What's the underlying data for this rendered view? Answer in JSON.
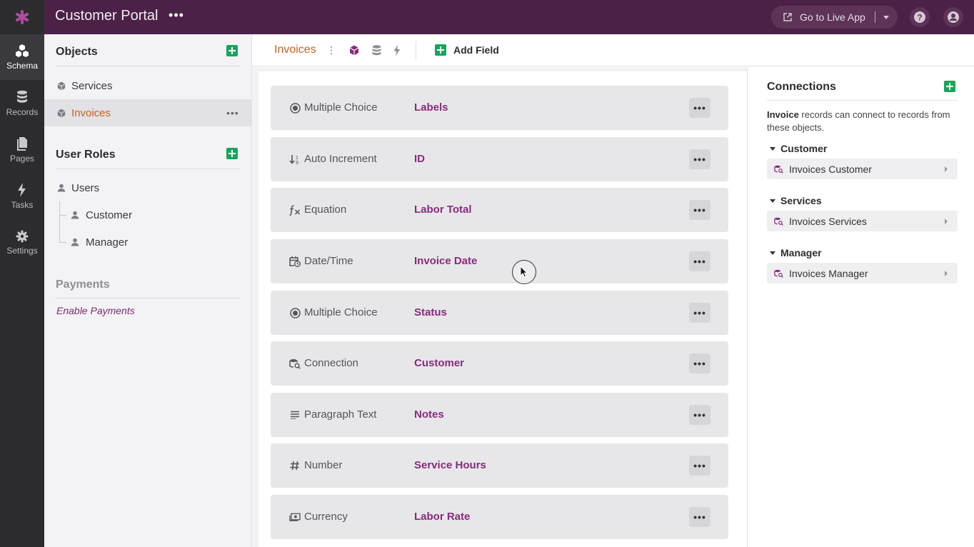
{
  "app": {
    "title": "Customer Portal",
    "menu_label": "•••",
    "go_live_label": "Go to Live App",
    "accent_color": "#4c2147"
  },
  "nav": {
    "items": [
      {
        "label": "Schema",
        "icon": "schema-icon",
        "active": true
      },
      {
        "label": "Records",
        "icon": "database-icon",
        "active": false
      },
      {
        "label": "Pages",
        "icon": "pages-icon",
        "active": false
      },
      {
        "label": "Tasks",
        "icon": "lightning-icon",
        "active": false
      },
      {
        "label": "Settings",
        "icon": "gear-icon",
        "active": false
      }
    ]
  },
  "sidebar": {
    "objects_heading": "Objects",
    "objects": [
      {
        "label": "Services",
        "active": false
      },
      {
        "label": "Invoices",
        "active": true,
        "more": "•••"
      }
    ],
    "roles_heading": "User Roles",
    "roles": [
      {
        "label": "Users"
      },
      {
        "label": "Customer"
      },
      {
        "label": "Manager"
      }
    ],
    "payments_heading": "Payments",
    "payments_link": "Enable Payments"
  },
  "main": {
    "title": "Invoices",
    "more": "⋮",
    "add_field_label": "Add Field",
    "fields": [
      {
        "type": "Multiple Choice",
        "icon": "radio-icon",
        "name": "Labels"
      },
      {
        "type": "Auto Increment",
        "icon": "sort-numeric-icon",
        "name": "ID"
      },
      {
        "type": "Equation",
        "icon": "function-icon",
        "name": "Labor Total"
      },
      {
        "type": "Date/Time",
        "icon": "calendar-clock-icon",
        "name": "Invoice Date"
      },
      {
        "type": "Multiple Choice",
        "icon": "radio-icon",
        "name": "Status"
      },
      {
        "type": "Connection",
        "icon": "connection-icon",
        "name": "Customer"
      },
      {
        "type": "Paragraph Text",
        "icon": "paragraph-icon",
        "name": "Notes"
      },
      {
        "type": "Number",
        "icon": "hash-icon",
        "name": "Service Hours"
      },
      {
        "type": "Currency",
        "icon": "currency-icon",
        "name": "Labor Rate"
      }
    ],
    "field_menu": "•••"
  },
  "connections": {
    "title": "Connections",
    "desc_bold": "Invoice",
    "desc_rest": " records can connect to records from these objects.",
    "groups": [
      {
        "name": "Customer",
        "item": "Invoices Customer"
      },
      {
        "name": "Services",
        "item": "Invoices Services"
      },
      {
        "name": "Manager",
        "item": "Invoices Manager"
      }
    ]
  }
}
